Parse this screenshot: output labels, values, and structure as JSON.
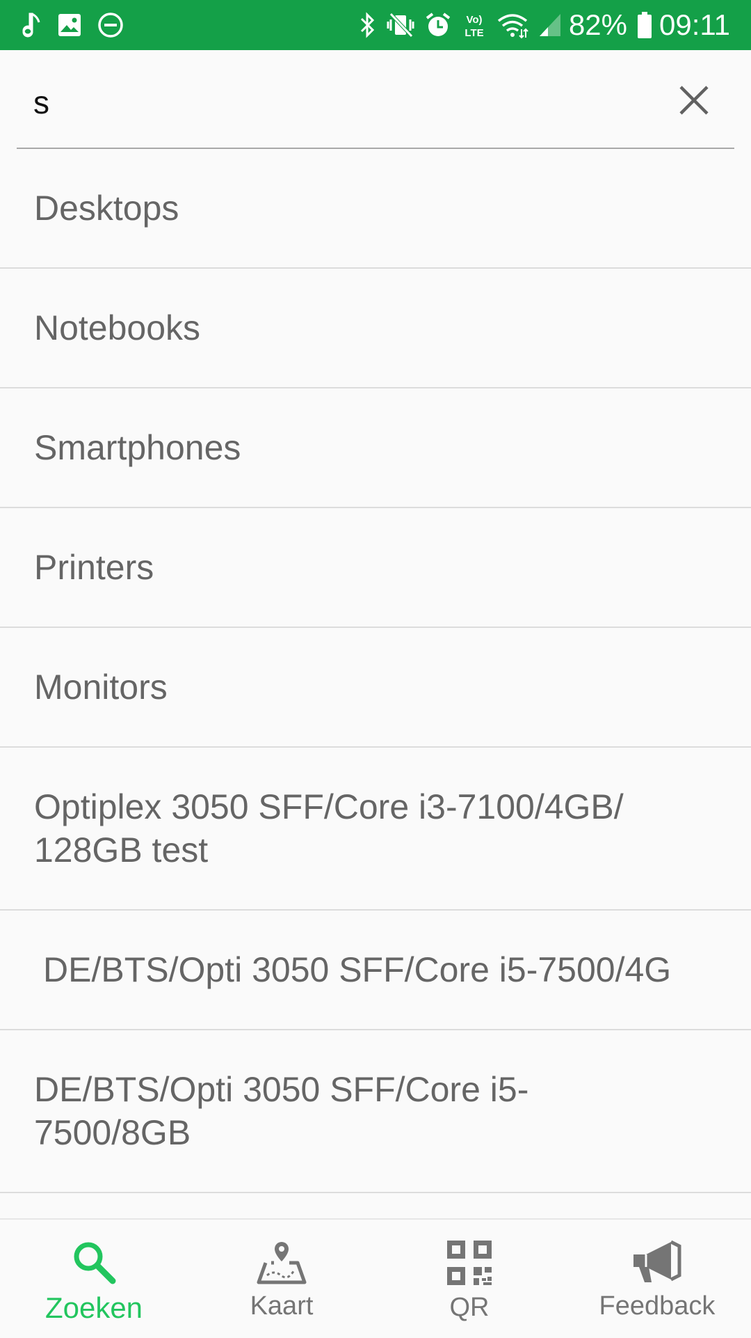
{
  "status_bar": {
    "battery": "82%",
    "time": "09:11",
    "left_icons": [
      "music-note-icon",
      "image-icon",
      "do-not-disturb-icon"
    ],
    "right_icons": [
      "bluetooth-icon",
      "vibrate-icon",
      "alarm-icon",
      "volte-icon",
      "wifi-icon",
      "signal-icon",
      "battery-icon"
    ],
    "color": "#14a048"
  },
  "search": {
    "value": "s",
    "placeholder": ""
  },
  "results": [
    "Desktops",
    "Notebooks",
    "Smartphones",
    "Printers",
    "Monitors",
    "Optiplex 3050 SFF/Core i3-7100/4GB/ 128GB test",
    " DE/BTS/Opti 3050 SFF/Core i5-7500/4G",
    "DE/BTS/Opti 3050 SFF/Core i5-7500/8GB"
  ],
  "bottom_nav": {
    "active": "Zoeken",
    "accent": "#22c55e",
    "tabs": [
      {
        "label": "Zoeken",
        "icon": "search-icon"
      },
      {
        "label": "Kaart",
        "icon": "map-icon"
      },
      {
        "label": "QR",
        "icon": "qr-code-icon"
      },
      {
        "label": "Feedback",
        "icon": "megaphone-icon"
      }
    ]
  }
}
